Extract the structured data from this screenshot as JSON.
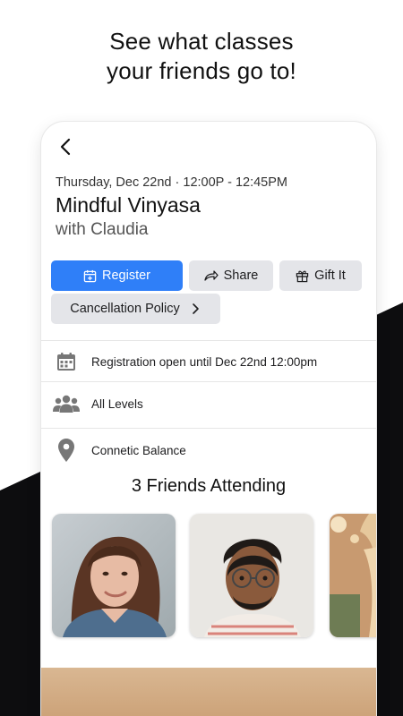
{
  "promo": {
    "line1": "See what classes",
    "line2": "your friends go to!"
  },
  "header": {
    "back_icon": "chevron-left-icon"
  },
  "event": {
    "datetime": "Thursday, Dec 22nd · 12:00P - 12:45PM",
    "title": "Mindful Vinyasa",
    "instructor": "with Claudia"
  },
  "actions": {
    "register": "Register",
    "share": "Share",
    "gift": "Gift It",
    "cancellation": "Cancellation Policy"
  },
  "info": {
    "registration": "Registration open until Dec 22nd 12:00pm",
    "level": "All Levels",
    "location": "Connetic Balance"
  },
  "friends": {
    "title": "3 Friends Attending",
    "items": [
      {
        "name": "friend-1"
      },
      {
        "name": "friend-2"
      },
      {
        "name": "friend-3"
      }
    ]
  },
  "colors": {
    "accent": "#2f7ff8",
    "button_bg": "#e4e5e9",
    "icon_gray": "#777777"
  }
}
